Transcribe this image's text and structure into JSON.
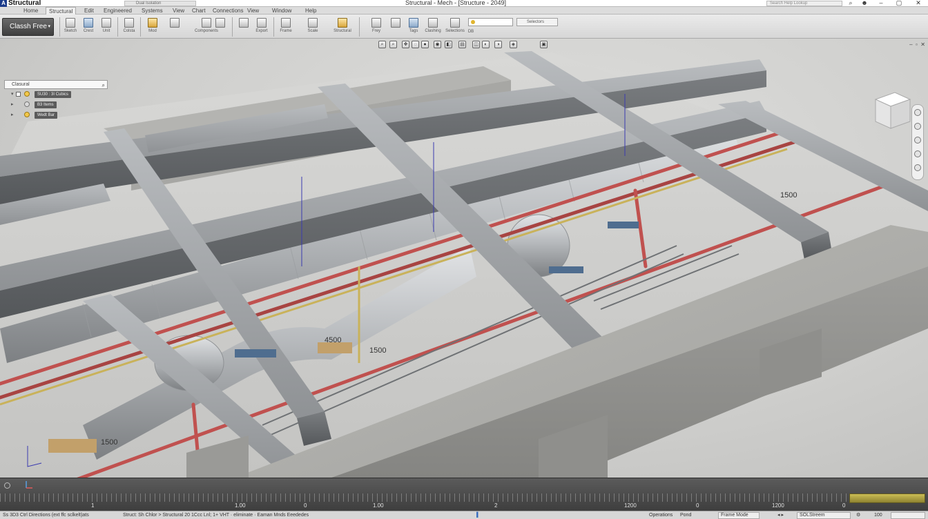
{
  "titlebar": {
    "app_name": "Structural",
    "qat_text": "Dual Isolation",
    "doc_title": "Structural - Mech - [Structure - 2049]",
    "search_placeholder": "Search Help Lookup"
  },
  "menu": {
    "items": [
      "Home",
      "Structural",
      "Edit",
      "Engineered",
      "Systems",
      "View",
      "Chart",
      "Connections",
      "View",
      "Window",
      "Help"
    ],
    "active_index": 1
  },
  "ribbon": {
    "clash_button": "Classh Free",
    "tools": [
      {
        "label": "Sketch",
        "icon": "sketch-icon"
      },
      {
        "label": "Crest",
        "icon": "crest-icon"
      },
      {
        "label": "Unit",
        "icon": "unit-icon"
      },
      {
        "label": "Colsta",
        "icon": "colsta-icon"
      },
      {
        "label": "Mod",
        "icon": "mod-icon"
      },
      {
        "label": "Components",
        "icon": "components-icon"
      },
      {
        "label": "Export",
        "icon": "export-icon"
      },
      {
        "label": "Frame",
        "icon": "frame-icon"
      },
      {
        "label": "Scale",
        "icon": "scale-icon"
      },
      {
        "label": "Structural",
        "icon": "structural-icon"
      },
      {
        "label": "Frey",
        "icon": "frey-icon"
      },
      {
        "label": "Tags",
        "icon": "tags-icon"
      },
      {
        "label": "Clashing",
        "icon": "clashing-icon"
      },
      {
        "label": "Selections",
        "icon": "selections-icon"
      },
      {
        "label": "DB",
        "icon": "db-icon"
      }
    ],
    "view_combo": "",
    "selector": "Selectors"
  },
  "browser": {
    "search_value": "Clasural",
    "items": [
      {
        "label": "SU30 : 3I Cubics",
        "expanded": true
      },
      {
        "label": "B3 Items"
      },
      {
        "label": "Wedt Bar"
      }
    ]
  },
  "viewport": {
    "nav_tools": [
      "zoom",
      "zoom-region",
      "pan",
      "orbit",
      "walk",
      "look",
      "section",
      "hide",
      "render",
      "lights",
      "materials",
      "properties",
      "camera"
    ],
    "annotations": [
      "1500",
      "1500",
      "1500",
      "4500"
    ]
  },
  "timeline": {
    "ticks": [
      "1",
      "1.00",
      "0",
      "1.00",
      "2",
      "1200",
      "0",
      "1200",
      "0"
    ]
  },
  "statusbar": {
    "left": "Ss 3D3 Ctrl Directions (ext ffc sclkelt)ats",
    "middle": "Struct: Sh Chlor > Structural  20 1Ccc  Lnl;  1+ VHT · eliminate  · Eaman  Mnds  Eeededes",
    "right_label": "Operations",
    "right_unit": "Pond",
    "right_field": "Frame Mode",
    "right_combo": "SOLStreem",
    "zoom": "100"
  },
  "colors": {
    "steel": "#8a8d90",
    "concrete": "#a9a9a6",
    "pipe_red": "#c0514f",
    "duct": "#bcbfc2",
    "timeline_accent": "#b5a83f"
  }
}
